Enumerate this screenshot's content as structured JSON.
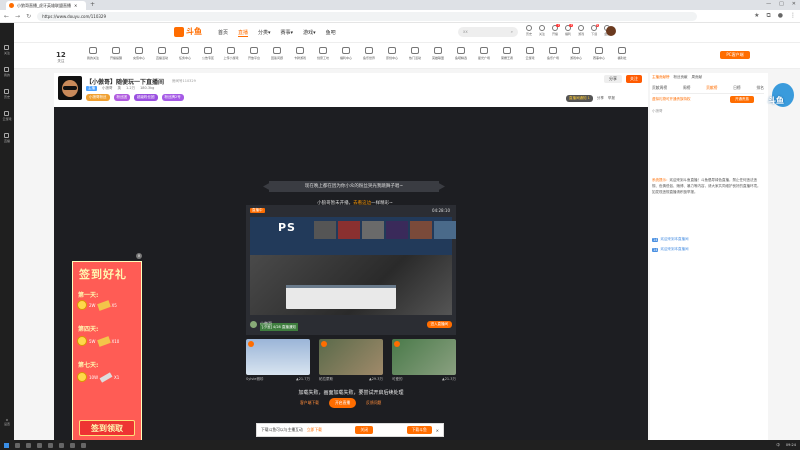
{
  "browser": {
    "tab_title": "小狼哥直播_虎牙英雄联盟直播",
    "url": "https://www.douyu.com/110329",
    "new_tab": "+",
    "window_controls": [
      "—",
      "□",
      "✕"
    ]
  },
  "left_sidebar": {
    "items": [
      {
        "label": "关注"
      },
      {
        "label": "我的"
      },
      {
        "label": "历史"
      },
      {
        "label": "云游戏"
      },
      {
        "label": "直播"
      }
    ],
    "bottom_label": "设置"
  },
  "header": {
    "logo_text": "斗鱼",
    "nav": [
      {
        "label": "首页",
        "active": false
      },
      {
        "label": "直播",
        "active": true
      },
      {
        "label": "分类▾",
        "active": false
      },
      {
        "label": "赛事▾",
        "active": false
      },
      {
        "label": "游戏▾",
        "active": false
      },
      {
        "label": "鱼吧",
        "active": false
      }
    ],
    "search_placeholder": "xx",
    "icons": [
      {
        "label": "历史",
        "badge": ""
      },
      {
        "label": "关注",
        "badge": ""
      },
      {
        "label": "开播",
        "badge": "1"
      },
      {
        "label": "福利",
        "badge": "2"
      },
      {
        "label": "游戏",
        "badge": ""
      },
      {
        "label": "下载",
        "badge": "9"
      },
      {
        "label": "会员",
        "badge": ""
      }
    ]
  },
  "category_bar": {
    "follow_count": "12",
    "follow_label": "关注",
    "categories": [
      "我的关注",
      "开播提醒",
      "充值中心",
      "直播活动",
      "任务中心",
      "公告专区",
      "上传小游戏",
      "开放平台",
      "回答问题",
      "卡牌游戏",
      "创意工坊",
      "福利中心",
      "鱼乐世界",
      "原创中心",
      "热门活动",
      "英雄联盟",
      "鱼吧精选",
      "星光广场",
      "荣耀王者",
      "云游戏",
      "鱼乐广场",
      "游戏中心",
      "赛事中心",
      "福利社"
    ],
    "pc_button": "PC客户端"
  },
  "room": {
    "title": "【小傲哥】随便玩一下直播间",
    "subtitle": "房间号110329",
    "host_level": "主播",
    "meta": [
      "小狼哥",
      "英",
      "1.2万",
      "180.3kg"
    ],
    "tags": [
      "小狼哥粉丝",
      "粉丝团",
      "超级粉丝团",
      "粉丝牌2号"
    ],
    "top_buttons": [
      "分享",
      "关注"
    ],
    "bottom_badge": "直播间通知 1",
    "bottom_items": [
      "分享",
      "举报"
    ]
  },
  "player": {
    "notice": "现在晚上都在因为你小众的粉丝哭光我跳舞子唱~",
    "offline_text": "小狼哥暂未开播，",
    "offline_highlight": "去看这边",
    "offline_tail": "一样精彩~",
    "featured": {
      "tag": "直播中",
      "time": "04:28:10",
      "ps_logo": "PS",
      "banner": "[小龙] 4/28 直播通知",
      "streamer": "小傲哥",
      "button": "进入直播间"
    },
    "recommendations": [
      {
        "name": "Sylvie雅珍",
        "viewers": "▲21.7万"
      },
      {
        "name": "帕拉蒙斯",
        "viewers": "▲29.3万"
      },
      {
        "name": "可爱的",
        "viewers": "▲21.3万"
      }
    ],
    "download_text": "加载失败，画面加载失败，要尝试开启后续处理",
    "download_buttons": [
      "客户端下载",
      "开启直播",
      "反馈问题"
    ]
  },
  "signin": {
    "title": "签到好礼",
    "days": [
      {
        "day": "第一天:",
        "reward1": "2W",
        "reward2": "X5"
      },
      {
        "day": "第四天:",
        "reward1": "5W",
        "reward2": "X10"
      },
      {
        "day": "第七天:",
        "reward1": "10W",
        "reward2": "X1"
      }
    ],
    "button": "签到领取",
    "close": "×"
  },
  "download_bar": {
    "text": "下载斗鱼可以与主播互动",
    "highlight": "立即下载",
    "button1": "关闭",
    "button2": "下载斗鱼",
    "close": "✕"
  },
  "chat": {
    "top": [
      {
        "label": "主播贡献榜"
      },
      {
        "label": "粉丝贡献"
      },
      {
        "label": "周贡献"
      }
    ],
    "tabs": [
      {
        "label": "贡献周榜",
        "active": false
      },
      {
        "label": "周榜",
        "active": false
      },
      {
        "label": "贡献榜",
        "active": true
      },
      {
        "label": "日榜",
        "active": false
      },
      {
        "label": "排名",
        "active": false
      }
    ],
    "rank_message": "虚拟礼物可开通贵族特权",
    "rank_button": "开通贵族",
    "anchor": "小狼哥",
    "system_prefix": "系统提示：",
    "system_text": "欢迎来到斗鱼直播！斗鱼倡导绿色直播，禁止任何违法违规、色情低俗、赌博、暴力等内容，请大家共同维护良好的直播环境。如发现违规直播请积极举报。",
    "messages": [
      {
        "level": "14",
        "text": "欢迎来到本直播间"
      },
      {
        "level": "14",
        "text": "欢迎来到本直播间"
      }
    ]
  },
  "mascot": {
    "text": "斗鱼"
  },
  "taskbar": {
    "tray": [
      "中",
      "09:24"
    ]
  }
}
